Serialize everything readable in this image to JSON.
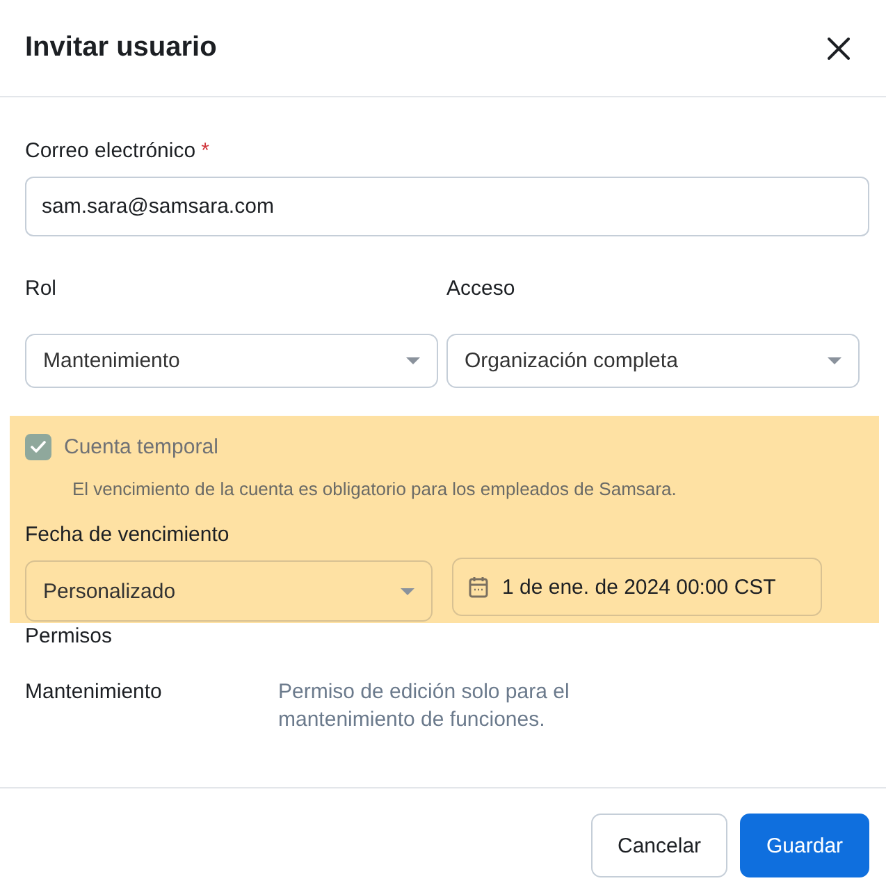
{
  "dialog": {
    "title": "Invitar usuario"
  },
  "email": {
    "label": "Correo electrónico",
    "required_mark": "*",
    "value": "sam.sara@samsara.com"
  },
  "role": {
    "label": "Rol",
    "value": "Mantenimiento"
  },
  "access": {
    "label": "Acceso",
    "value": "Organización completa"
  },
  "temporary": {
    "highlighted": true,
    "label": "Cuenta temporal",
    "checked": true,
    "disabled": true,
    "note": "El vencimiento de la cuenta es obligatorio para los empleados de Samsara."
  },
  "expiry": {
    "label": "Fecha de vencimiento",
    "preset": "Personalizado",
    "date": "1 de ene. de 2024 00:00 CST"
  },
  "permissions": {
    "title": "Permisos",
    "rows": [
      {
        "role": "Mantenimiento",
        "description": "Permiso de edición solo para el mantenimiento de funciones."
      }
    ]
  },
  "buttons": [
    {
      "label": "Cancelar",
      "kind": "secondary"
    },
    {
      "label": "Guardar",
      "kind": "primary"
    }
  ]
}
